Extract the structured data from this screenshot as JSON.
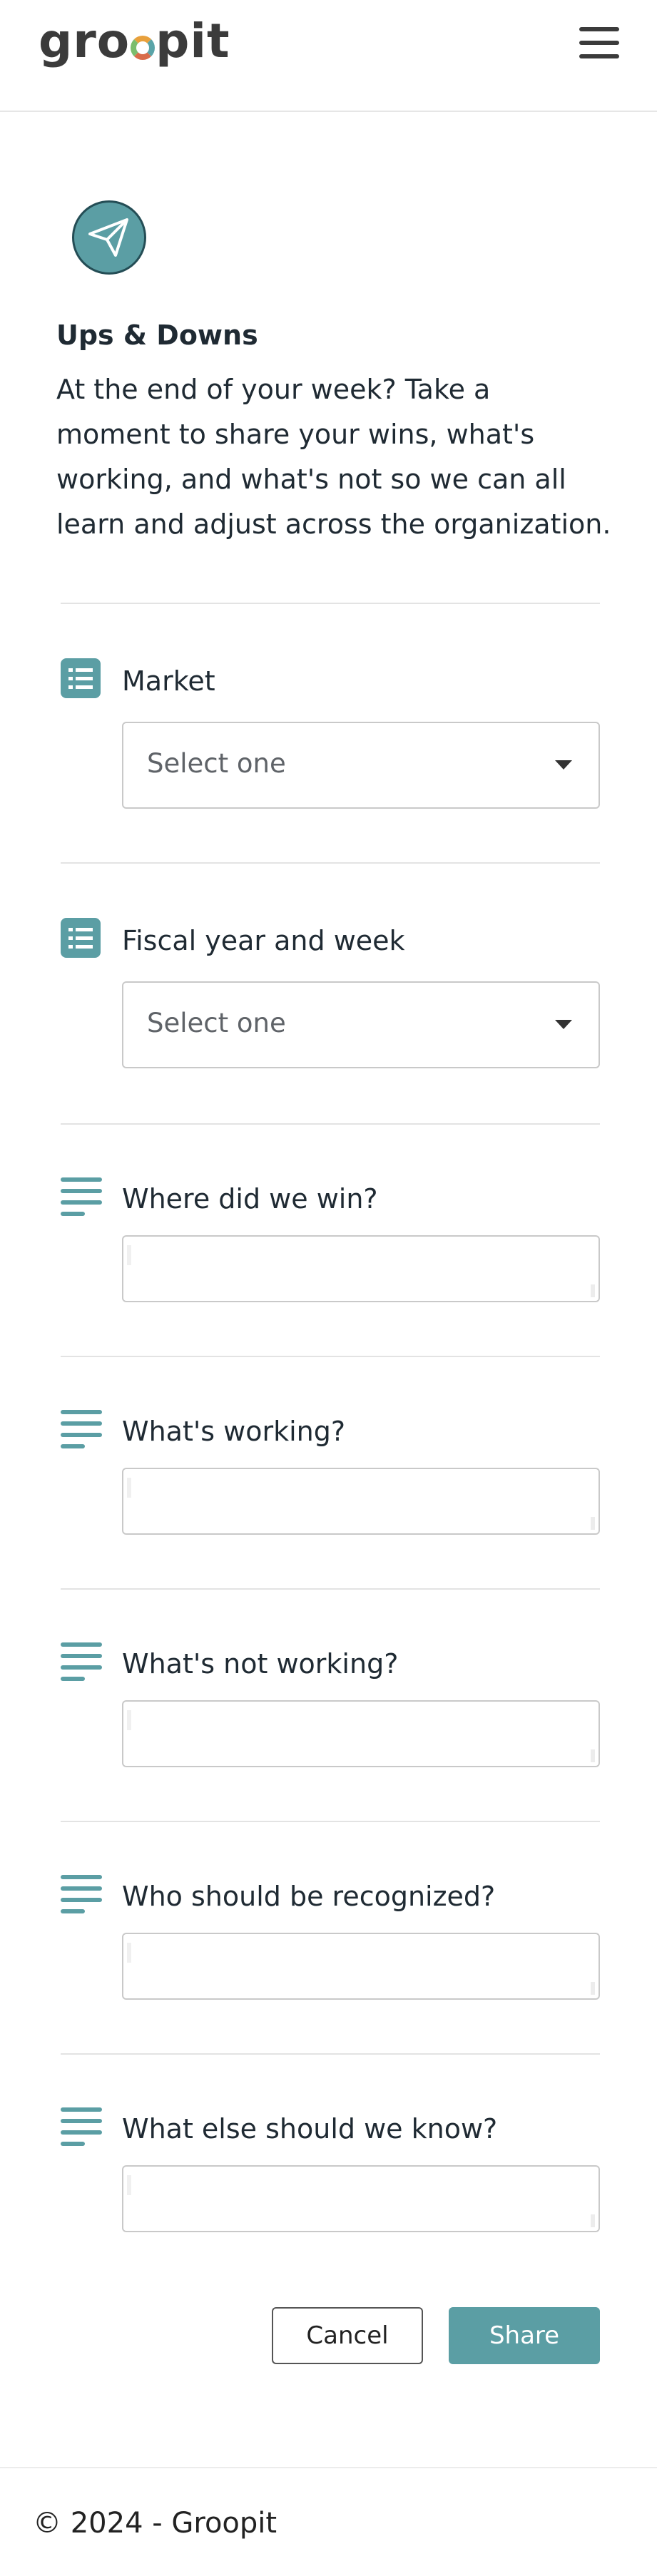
{
  "header": {
    "logo_text": "groopit",
    "menu_icon": "hamburger-icon"
  },
  "form": {
    "icon": "paper-plane-icon",
    "title": "Ups & Downs",
    "intro": "At the end of your week? Take a moment to share your wins, what's working, and what's not so we can all learn and adjust across the organization.",
    "fields": [
      {
        "label": "Market",
        "type": "select",
        "placeholder": "Select one",
        "icon": "list-icon"
      },
      {
        "label": "Fiscal year and week",
        "type": "select",
        "placeholder": "Select one",
        "icon": "list-icon"
      },
      {
        "label": "Where did we win?",
        "type": "text",
        "value": "",
        "icon": "text-lines-icon"
      },
      {
        "label": "What's working?",
        "type": "text",
        "value": "",
        "icon": "text-lines-icon"
      },
      {
        "label": "What's not working?",
        "type": "text",
        "value": "",
        "icon": "text-lines-icon"
      },
      {
        "label": "Who should be recognized?",
        "type": "text",
        "value": "",
        "icon": "text-lines-icon"
      },
      {
        "label": "What else should we know?",
        "type": "text",
        "value": "",
        "icon": "text-lines-icon"
      }
    ],
    "cancel_label": "Cancel",
    "share_label": "Share"
  },
  "footer": {
    "copyright": "© 2024 - Groopit"
  },
  "colors": {
    "accent": "#5b9ea4",
    "text": "#1f2a33",
    "border": "#c9c9c9"
  }
}
